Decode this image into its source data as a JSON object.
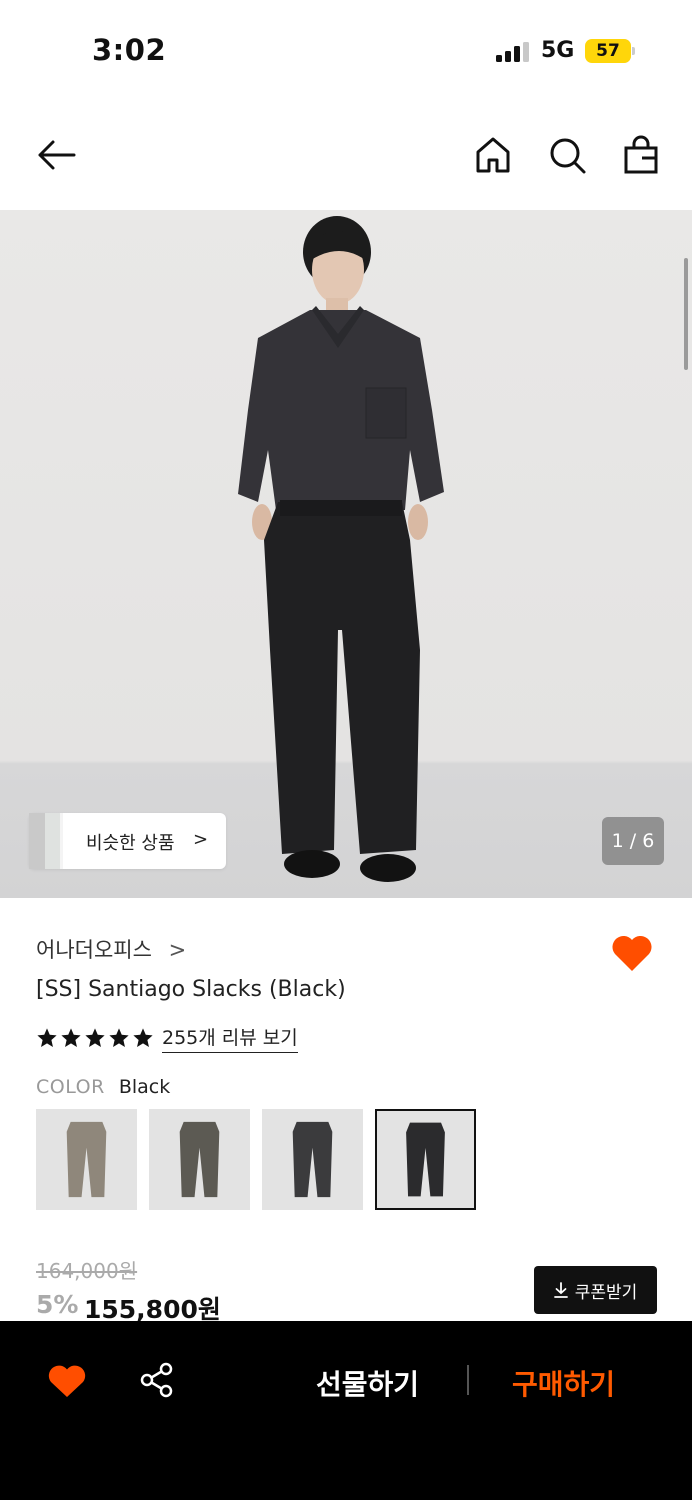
{
  "status_bar": {
    "time": "3:02",
    "network": "5G",
    "battery": "57"
  },
  "header": {
    "icons": [
      "arrow-left-icon",
      "home-icon",
      "search-icon",
      "shopping-bag-icon"
    ]
  },
  "gallery": {
    "similar_label": "비슷한 상품",
    "similar_chevron": ">",
    "pager": "1 / 6"
  },
  "product": {
    "brand": "어나더오피스",
    "brand_chevron": ">",
    "title": "[SS] Santiago Slacks (Black)",
    "rating_stars": 5,
    "review_link": "255개 리뷰 보기",
    "color_key": "COLOR",
    "color_value": "Black",
    "swatches": [
      {
        "name": "beige",
        "color": "#8f877b"
      },
      {
        "name": "olive",
        "color": "#5c5a53"
      },
      {
        "name": "charcoal",
        "color": "#3b3b3d"
      },
      {
        "name": "black",
        "color": "#2b2b2d",
        "selected": true
      }
    ],
    "original_price": "164,000원",
    "discount": "5%",
    "sale_price": "155,800원",
    "coupon_label": "쿠폰받기"
  },
  "bottom_bar": {
    "gift_label": "선물하기",
    "buy_label": "구매하기",
    "accent_color": "#ff5a00"
  }
}
